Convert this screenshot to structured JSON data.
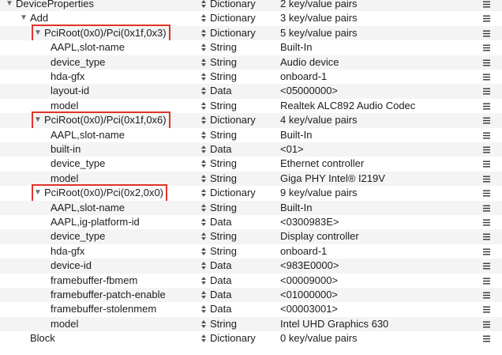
{
  "plist": {
    "rows": [
      {
        "key": "DeviceProperties",
        "type": "Dictionary",
        "value": "2 key/value pairs",
        "depth": 0,
        "expandable": true,
        "highlight": false
      },
      {
        "key": "Add",
        "type": "Dictionary",
        "value": "3 key/value pairs",
        "depth": 1,
        "expandable": true,
        "highlight": false
      },
      {
        "key": "PciRoot(0x0)/Pci(0x1f,0x3)",
        "type": "Dictionary",
        "value": "5 key/value pairs",
        "depth": 2,
        "expandable": true,
        "highlight": true
      },
      {
        "key": "AAPL,slot-name",
        "type": "String",
        "value": "Built-In",
        "depth": 3,
        "expandable": false,
        "highlight": false
      },
      {
        "key": "device_type",
        "type": "String",
        "value": "Audio device",
        "depth": 3,
        "expandable": false,
        "highlight": false
      },
      {
        "key": "hda-gfx",
        "type": "String",
        "value": "onboard-1",
        "depth": 3,
        "expandable": false,
        "highlight": false
      },
      {
        "key": "layout-id",
        "type": "Data",
        "value": "<05000000>",
        "depth": 3,
        "expandable": false,
        "highlight": false
      },
      {
        "key": "model",
        "type": "String",
        "value": "Realtek ALC892 Audio Codec",
        "depth": 3,
        "expandable": false,
        "highlight": false
      },
      {
        "key": "PciRoot(0x0)/Pci(0x1f,0x6)",
        "type": "Dictionary",
        "value": "4 key/value pairs",
        "depth": 2,
        "expandable": true,
        "highlight": true
      },
      {
        "key": "AAPL,slot-name",
        "type": "String",
        "value": "Built-In",
        "depth": 3,
        "expandable": false,
        "highlight": false
      },
      {
        "key": "built-in",
        "type": "Data",
        "value": "<01>",
        "depth": 3,
        "expandable": false,
        "highlight": false
      },
      {
        "key": "device_type",
        "type": "String",
        "value": "Ethernet controller",
        "depth": 3,
        "expandable": false,
        "highlight": false
      },
      {
        "key": "model",
        "type": "String",
        "value": "Giga PHY Intel® I219V",
        "depth": 3,
        "expandable": false,
        "highlight": false
      },
      {
        "key": "PciRoot(0x0)/Pci(0x2,0x0)",
        "type": "Dictionary",
        "value": "9 key/value pairs",
        "depth": 2,
        "expandable": true,
        "highlight": true
      },
      {
        "key": "AAPL,slot-name",
        "type": "String",
        "value": "Built-In",
        "depth": 3,
        "expandable": false,
        "highlight": false
      },
      {
        "key": "AAPL,ig-platform-id",
        "type": "Data",
        "value": "<0300983E>",
        "depth": 3,
        "expandable": false,
        "highlight": false
      },
      {
        "key": "device_type",
        "type": "String",
        "value": "Display controller",
        "depth": 3,
        "expandable": false,
        "highlight": false
      },
      {
        "key": "hda-gfx",
        "type": "String",
        "value": "onboard-1",
        "depth": 3,
        "expandable": false,
        "highlight": false
      },
      {
        "key": "device-id",
        "type": "Data",
        "value": "<983E0000>",
        "depth": 3,
        "expandable": false,
        "highlight": false
      },
      {
        "key": "framebuffer-fbmem",
        "type": "Data",
        "value": "<00009000>",
        "depth": 3,
        "expandable": false,
        "highlight": false
      },
      {
        "key": "framebuffer-patch-enable",
        "type": "Data",
        "value": "<01000000>",
        "depth": 3,
        "expandable": false,
        "highlight": false
      },
      {
        "key": "framebuffer-stolenmem",
        "type": "Data",
        "value": "<00003001>",
        "depth": 3,
        "expandable": false,
        "highlight": false
      },
      {
        "key": "model",
        "type": "String",
        "value": "Intel UHD Graphics 630",
        "depth": 3,
        "expandable": false,
        "highlight": false
      },
      {
        "key": "Block",
        "type": "Dictionary",
        "value": "0 key/value pairs",
        "depth": 1,
        "expandable": false,
        "highlight": false
      }
    ]
  },
  "icons": {
    "disclosure": "disclosure-triangle-icon",
    "type_stepper": "stepper-arrows-icon",
    "row_menu": "hamburger-menu-icon"
  },
  "colors": {
    "highlight_border": "#e0342b",
    "row_alt": "#f4f4f4",
    "text": "#1d1d1d"
  }
}
